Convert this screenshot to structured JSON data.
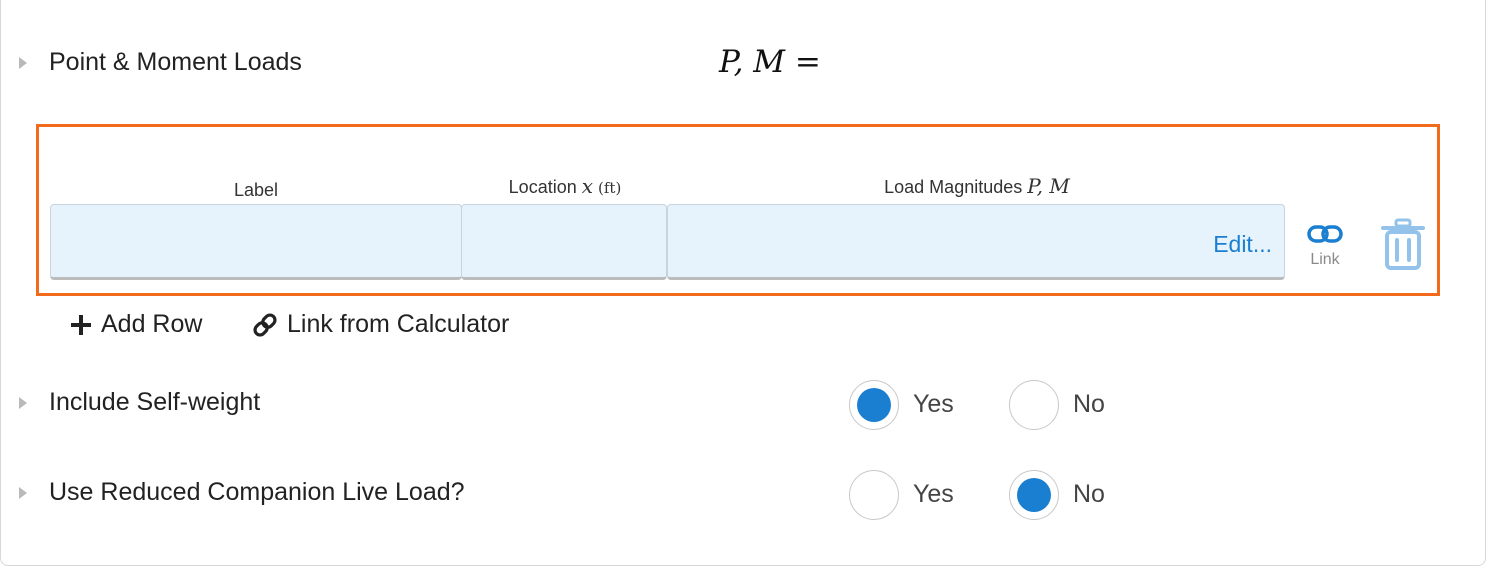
{
  "point_moment": {
    "label": "Point & Moment Loads",
    "formula": "P, M ="
  },
  "table": {
    "columns": {
      "label": "Label",
      "location_prefix": "Location ",
      "location_var": "x",
      "location_unit": "(ft)",
      "magnitudes_prefix": "Load Magnitudes ",
      "magnitudes_vars": "P, M"
    },
    "row": {
      "label_value": "",
      "location_value": "",
      "edit_label": "Edit..."
    },
    "link_label": "Link"
  },
  "actions": {
    "add_row": "Add Row",
    "link_from_calculator": "Link from Calculator"
  },
  "self_weight": {
    "label": "Include Self-weight",
    "yes": "Yes",
    "no": "No",
    "selected": "Yes"
  },
  "reduced_live": {
    "label": "Use Reduced Companion Live Load?",
    "yes": "Yes",
    "no": "No",
    "selected": "No"
  },
  "colors": {
    "highlight_border": "#f26b1d",
    "accent": "#1a7fd1",
    "cell_bg": "#e6f3fd"
  },
  "icons": [
    "triangle-right-icon",
    "plus-icon",
    "link-chain-icon",
    "trash-icon"
  ]
}
